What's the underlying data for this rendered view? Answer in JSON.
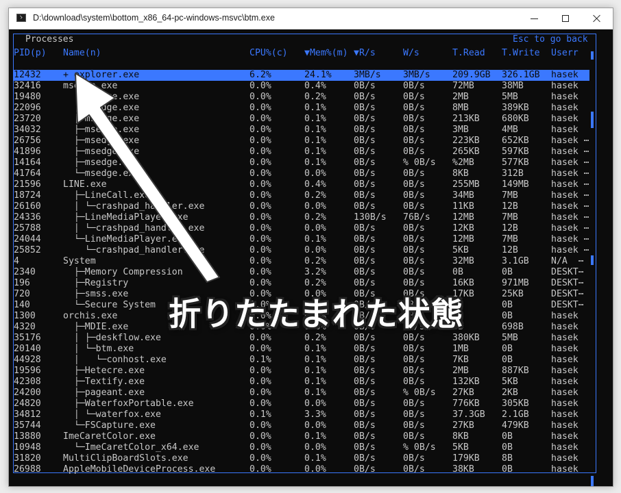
{
  "window": {
    "title": "D:\\download\\system\\bottom_x86_64-pc-windows-msvc\\btm.exe"
  },
  "panel": {
    "title": "Processes",
    "help_text": "Esc to go back"
  },
  "columns": [
    "PID(p)",
    "Name(n)",
    "CPU%(c)",
    "▼Mem%(m)",
    "▼R/s",
    "W/s",
    "T.Read",
    "T.Write",
    "Userr"
  ],
  "rows": [
    {
      "pid": "12432",
      "name": "+ explorer.exe",
      "cpu": "6.2%",
      "mem": "24.1%",
      "rs": "3MB/s",
      "ws": "3MB/s",
      "tread": "209.9GB",
      "twrite": "326.1GB",
      "user": "hasek",
      "selected": true
    },
    {
      "pid": "32416",
      "name": "msedge.exe",
      "cpu": "0.0%",
      "mem": "0.4%",
      "rs": "0B/s",
      "ws": "0B/s",
      "tread": "72MB",
      "twrite": "38MB",
      "user": "hasek"
    },
    {
      "pid": "19480",
      "name": "  ├─msedge.exe",
      "cpu": "0.0%",
      "mem": "0.2%",
      "rs": "0B/s",
      "ws": "0B/s",
      "tread": "2MB",
      "twrite": "5MB",
      "user": "hasek"
    },
    {
      "pid": "22096",
      "name": "  ├─msedge.exe",
      "cpu": "0.0%",
      "mem": "0.1%",
      "rs": "0B/s",
      "ws": "0B/s",
      "tread": "8MB",
      "twrite": "389KB",
      "user": "hasek"
    },
    {
      "pid": "23720",
      "name": "  ├─msedge.exe",
      "cpu": "0.0%",
      "mem": "0.1%",
      "rs": "0B/s",
      "ws": "0B/s",
      "tread": "213KB",
      "twrite": "680KB",
      "user": "hasek"
    },
    {
      "pid": "34032",
      "name": "  ├─msedge.exe",
      "cpu": "0.0%",
      "mem": "0.1%",
      "rs": "0B/s",
      "ws": "0B/s",
      "tread": "3MB",
      "twrite": "4MB",
      "user": "hasek"
    },
    {
      "pid": "26756",
      "name": "  ├─msedge.exe",
      "cpu": "0.0%",
      "mem": "0.1%",
      "rs": "0B/s",
      "ws": "0B/s",
      "tread": "223KB",
      "twrite": "652KB",
      "user": "hasek ⋯"
    },
    {
      "pid": "41896",
      "name": "  ├─msedge.exe",
      "cpu": "0.0%",
      "mem": "0.1%",
      "rs": "0B/s",
      "ws": "0B/s",
      "tread": "265KB",
      "twrite": "597KB",
      "user": "hasek ⋯"
    },
    {
      "pid": "14164",
      "name": "  ├─msedge.exe",
      "cpu": "0.0%",
      "mem": "0.1%",
      "rs": "0B/s",
      "ws": "% 0B/s",
      "tread": "%2MB",
      "twrite": "577KB",
      "user": "hasek ⋯"
    },
    {
      "pid": "41764",
      "name": "  └─msedge.exe",
      "cpu": "0.0%",
      "mem": "0.0%",
      "rs": "0B/s",
      "ws": "0B/s",
      "tread": "8KB",
      "twrite": "312B",
      "user": "hasek ⋯"
    },
    {
      "pid": "21596",
      "name": "LINE.exe",
      "cpu": "0.0%",
      "mem": "0.4%",
      "rs": "0B/s",
      "ws": "0B/s",
      "tread": "255MB",
      "twrite": "149MB",
      "user": "hasek ⋯"
    },
    {
      "pid": "18724",
      "name": "  ├─LineCall.exe",
      "cpu": "0.0%",
      "mem": "0.2%",
      "rs": "0B/s",
      "ws": "0B/s",
      "tread": "34MB",
      "twrite": "7MB",
      "user": "hasek ⋯"
    },
    {
      "pid": "26160",
      "name": "  │ └─crashpad_handler.exe",
      "cpu": "0.0%",
      "mem": "0.0%",
      "rs": "0B/s",
      "ws": "0B/s",
      "tread": "11KB",
      "twrite": "12B",
      "user": "hasek ⋯"
    },
    {
      "pid": "24336",
      "name": "  ├─LineMediaPlayer.exe",
      "cpu": "0.0%",
      "mem": "0.2%",
      "rs": "130B/s",
      "ws": "76B/s",
      "tread": "12MB",
      "twrite": "7MB",
      "user": "hasek ⋯"
    },
    {
      "pid": "25788",
      "name": "  │ └─crashpad_handler.exe",
      "cpu": "0.0%",
      "mem": "0.0%",
      "rs": "0B/s",
      "ws": "0B/s",
      "tread": "12KB",
      "twrite": "12B",
      "user": "hasek ⋯"
    },
    {
      "pid": "24044",
      "name": "  └─LineMediaPlayer.exe",
      "cpu": "0.0%",
      "mem": "0.1%",
      "rs": "0B/s",
      "ws": "0B/s",
      "tread": "12MB",
      "twrite": "7MB",
      "user": "hasek ⋯"
    },
    {
      "pid": "25852",
      "name": "    └─crashpad_handler.exe",
      "cpu": "0.0%",
      "mem": "0.0%",
      "rs": "0B/s",
      "ws": "0B/s",
      "tread": "5KB",
      "twrite": "12B",
      "user": "hasek ⋯"
    },
    {
      "pid": "4",
      "name": "System",
      "cpu": "0.0%",
      "mem": "0.2%",
      "rs": "0B/s",
      "ws": "0B/s",
      "tread": "32MB",
      "twrite": "3.1GB",
      "user": "N/A  ⋯"
    },
    {
      "pid": "2340",
      "name": "  ├─Memory Compression",
      "cpu": "0.0%",
      "mem": "3.2%",
      "rs": "0B/s",
      "ws": "0B/s",
      "tread": "0B",
      "twrite": "0B",
      "user": "DESKT⋯"
    },
    {
      "pid": "196",
      "name": "  ├─Registry",
      "cpu": "0.0%",
      "mem": "0.2%",
      "rs": "0B/s",
      "ws": "0B/s",
      "tread": "16KB",
      "twrite": "971MB",
      "user": "DESKT⋯"
    },
    {
      "pid": "720",
      "name": "  ├─smss.exe",
      "cpu": "0.0%",
      "mem": "0.0%",
      "rs": "0B/s",
      "ws": "0B/s",
      "tread": "17KB",
      "twrite": "25KB",
      "user": "DESKT⋯"
    },
    {
      "pid": "140",
      "name": "  └─Secure System",
      "cpu": "0.0%",
      "mem": "0.0%",
      "rs": "0B/s",
      "ws": "0B/s",
      "tread": "0B",
      "twrite": "0B",
      "user": "DESKT⋯"
    },
    {
      "pid": "1300",
      "name": "orchis.exe",
      "cpu": "0.0%",
      "mem": "0.0%",
      "rs": "0B/s",
      "ws": "0B/s",
      "tread": "0B",
      "twrite": "0B",
      "user": "hasek"
    },
    {
      "pid": "4320",
      "name": "  ├─MDIE.exe",
      "cpu": "0.0%",
      "mem": "0.0%",
      "rs": "0B/s",
      "ws": "0B/s",
      "tread": "0B",
      "twrite": "698B",
      "user": "hasek"
    },
    {
      "pid": "35176",
      "name": "  │ ├─deskflow.exe",
      "cpu": "0.0%",
      "mem": "0.2%",
      "rs": "0B/s",
      "ws": "0B/s",
      "tread": "380KB",
      "twrite": "5MB",
      "user": "hasek"
    },
    {
      "pid": "20140",
      "name": "  │ └─btm.exe",
      "cpu": "0.0%",
      "mem": "0.1%",
      "rs": "0B/s",
      "ws": "0B/s",
      "tread": "1MB",
      "twrite": "0B",
      "user": "hasek"
    },
    {
      "pid": "44928",
      "name": "  │   └─conhost.exe",
      "cpu": "0.1%",
      "mem": "0.1%",
      "rs": "0B/s",
      "ws": "0B/s",
      "tread": "7KB",
      "twrite": "0B",
      "user": "hasek"
    },
    {
      "pid": "19596",
      "name": "  ├─Hetecre.exe",
      "cpu": "0.0%",
      "mem": "0.1%",
      "rs": "0B/s",
      "ws": "0B/s",
      "tread": "2MB",
      "twrite": "887KB",
      "user": "hasek"
    },
    {
      "pid": "42308",
      "name": "  ├─Textify.exe",
      "cpu": "0.0%",
      "mem": "0.1%",
      "rs": "0B/s",
      "ws": "0B/s",
      "tread": "132KB",
      "twrite": "5KB",
      "user": "hasek"
    },
    {
      "pid": "24200",
      "name": "  ├─pageant.exe",
      "cpu": "0.0%",
      "mem": "0.1%",
      "rs": "0B/s",
      "ws": "% 0B/s",
      "tread": "27KB",
      "twrite": "2KB",
      "user": "hasek"
    },
    {
      "pid": "24820",
      "name": "  ├─WaterfoxPortable.exe",
      "cpu": "0.0%",
      "mem": "0.0%",
      "rs": "0B/s",
      "ws": "0B/s",
      "tread": "776KB",
      "twrite": "305KB",
      "user": "hasek"
    },
    {
      "pid": "34812",
      "name": "  │ └─waterfox.exe",
      "cpu": "0.1%",
      "mem": "3.3%",
      "rs": "0B/s",
      "ws": "0B/s",
      "tread": "37.3GB",
      "twrite": "2.1GB",
      "user": "hasek"
    },
    {
      "pid": "35744",
      "name": "  └─FSCapture.exe",
      "cpu": "0.0%",
      "mem": "0.0%",
      "rs": "0B/s",
      "ws": "0B/s",
      "tread": "27KB",
      "twrite": "479KB",
      "user": "hasek"
    },
    {
      "pid": "13880",
      "name": "ImeCaretColor.exe",
      "cpu": "0.0%",
      "mem": "0.1%",
      "rs": "0B/s",
      "ws": "0B/s",
      "tread": "8KB",
      "twrite": "0B",
      "user": "hasek"
    },
    {
      "pid": "10948",
      "name": "  └─ImeCaretColor_x64.exe",
      "cpu": "0.0%",
      "mem": "0.0%",
      "rs": "0B/s",
      "ws": "% 0B/s",
      "tread": "5KB",
      "twrite": "0B",
      "user": "hasek"
    },
    {
      "pid": "31820",
      "name": "MultiClipBoardSlots.exe",
      "cpu": "0.0%",
      "mem": "0.1%",
      "rs": "0B/s",
      "ws": "0B/s",
      "tread": "179KB",
      "twrite": "8B",
      "user": "hasek"
    },
    {
      "pid": "26988",
      "name": "AppleMobileDeviceProcess.exe",
      "cpu": "0.0%",
      "mem": "0.0%",
      "rs": "0B/s",
      "ws": "0B/s",
      "tread": "38KB",
      "twrite": "0B",
      "user": "hasek"
    }
  ],
  "annotation": {
    "caption": "折りたたまれた状態",
    "arrow_color": "#ffffff"
  },
  "colors": {
    "accent": "#3b78ff",
    "background": "#0c0c0c",
    "text": "#c8c8c8"
  }
}
